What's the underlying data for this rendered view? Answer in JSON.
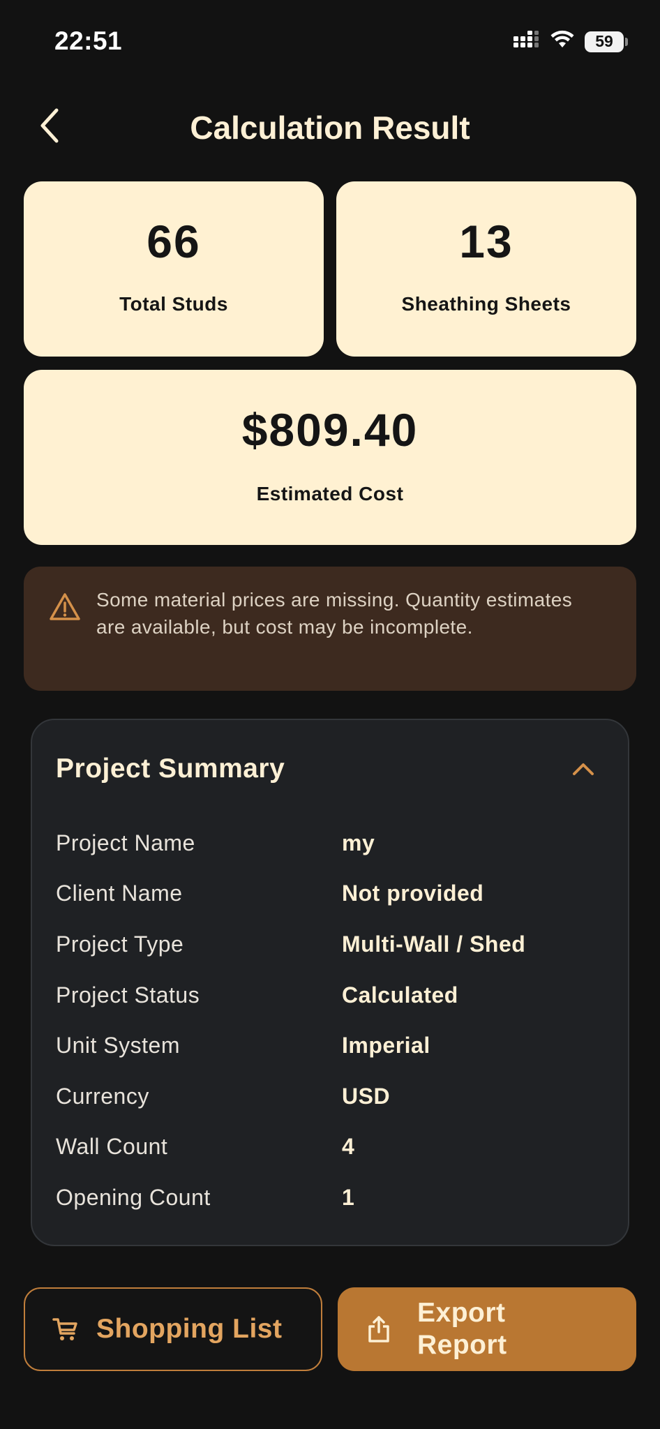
{
  "status_bar": {
    "time": "22:51",
    "battery": "59"
  },
  "header": {
    "title": "Calculation Result"
  },
  "stats": {
    "studs": {
      "value": "66",
      "label": "Total Studs"
    },
    "sheets": {
      "value": "13",
      "label": "Sheathing Sheets"
    },
    "cost": {
      "value": "$809.40",
      "label": "Estimated Cost"
    }
  },
  "warning": {
    "text": "Some material prices are missing. Quantity estimates are available, but cost may be incomplete."
  },
  "summary": {
    "title": "Project Summary",
    "rows": [
      {
        "label": "Project Name",
        "value": "my"
      },
      {
        "label": "Client Name",
        "value": "Not provided"
      },
      {
        "label": "Project Type",
        "value": "Multi-Wall / Shed"
      },
      {
        "label": "Project Status",
        "value": "Calculated"
      },
      {
        "label": "Unit System",
        "value": "Imperial"
      },
      {
        "label": "Currency",
        "value": "USD"
      },
      {
        "label": "Wall Count",
        "value": "4"
      },
      {
        "label": "Opening Count",
        "value": "1"
      }
    ]
  },
  "actions": {
    "shopping_list": "Shopping List",
    "export_report": "Export Report"
  },
  "colors": {
    "background": "#121212",
    "card": "#fff1d2",
    "accent": "#b97732",
    "warning_bg": "#3d2a1f"
  }
}
